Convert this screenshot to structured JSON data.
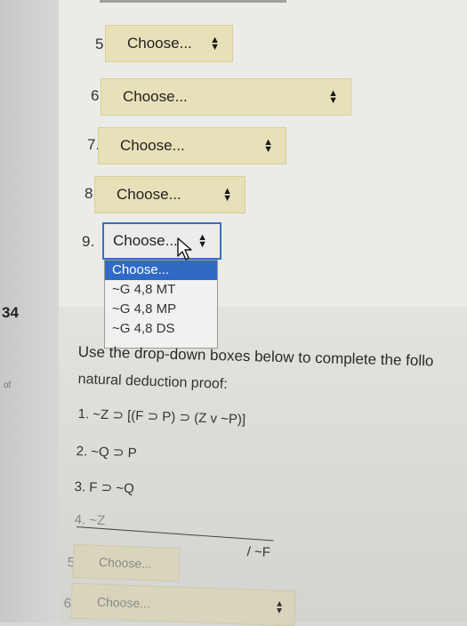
{
  "dropdowns": [
    {
      "number": "5.",
      "value": "Choose..."
    },
    {
      "number": "6.",
      "value": "Choose..."
    },
    {
      "number": "7.",
      "value": "Choose..."
    },
    {
      "number": "8.",
      "value": "Choose..."
    },
    {
      "number": "9.",
      "value": "Choose..."
    }
  ],
  "open_dropdown": {
    "options": [
      "Choose...",
      "~G 4,8 MT",
      "~G 4,8 MP",
      "~G 4,8 DS"
    ],
    "selected_index": 0
  },
  "question": {
    "number": "34",
    "side_label": "of",
    "instruction_line1": "Use the drop-down boxes below to complete the follo",
    "instruction_line2": "natural deduction proof:",
    "lines": [
      "1. ~Z ⊃ [(F ⊃ P) ⊃ (Z v ~P)]",
      "2. ~Q ⊃ P",
      "3. F ⊃ ~Q",
      "4. ~Z"
    ],
    "conclusion": "/ ~F",
    "faded_rows": [
      {
        "number": "5.",
        "value": "Choose..."
      },
      {
        "number": "6.",
        "value": "Choose..."
      }
    ]
  },
  "colors": {
    "select_bg": "#e8e0b8",
    "selected_option": "#2f6ac4",
    "focus_border": "#3b6fc2"
  }
}
